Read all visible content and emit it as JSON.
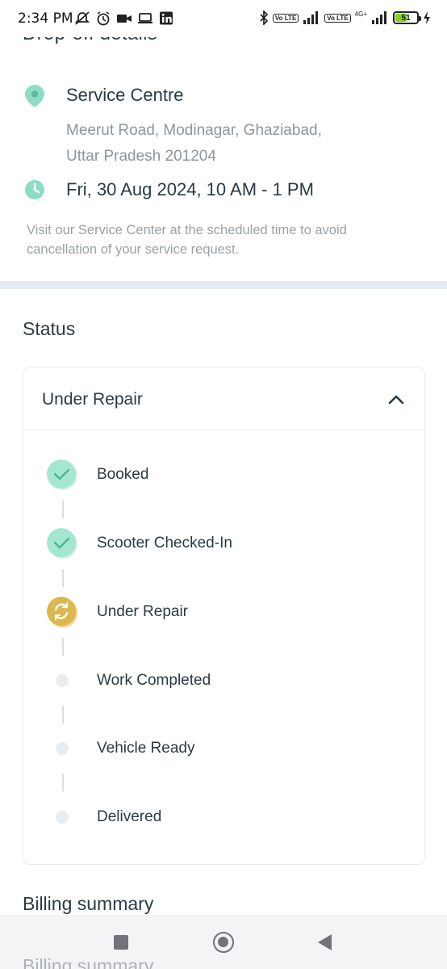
{
  "status_bar": {
    "time": "2:34 PM",
    "battery": "51",
    "battery_percent": 51,
    "network_label": "4G+",
    "volte_label": "Vo LTE"
  },
  "dropoff": {
    "section_title": "Drop-off details",
    "place_name": "Service Centre",
    "address_line1": "Meerut Road, Modinagar, Ghaziabad,",
    "address_line2": "Uttar Pradesh 201204",
    "datetime": "Fri, 30 Aug 2024, 10 AM - 1 PM",
    "note": "Visit our Service Center at the scheduled time to avoid cancellation of your service request.",
    "icons": {
      "location": "location-pin-icon",
      "time": "clock-icon"
    },
    "accent_color": "#7dd8c0"
  },
  "status": {
    "heading": "Status",
    "current": "Under Repair",
    "steps": [
      {
        "label": "Booked",
        "state": "done",
        "icon": "check-icon"
      },
      {
        "label": "Scooter Checked-In",
        "state": "done",
        "icon": "check-icon"
      },
      {
        "label": "Under Repair",
        "state": "in-progress",
        "icon": "refresh-icon"
      },
      {
        "label": "Work Completed",
        "state": "pending",
        "icon": "dot-icon"
      },
      {
        "label": "Vehicle Ready",
        "state": "pending",
        "icon": "dot-icon"
      },
      {
        "label": "Delivered",
        "state": "pending",
        "icon": "dot-icon"
      }
    ],
    "colors": {
      "done": "#9be3cc",
      "in_progress": "#e3c25a",
      "pending": "#e8edf2"
    }
  },
  "billing": {
    "heading": "Billing summary"
  }
}
